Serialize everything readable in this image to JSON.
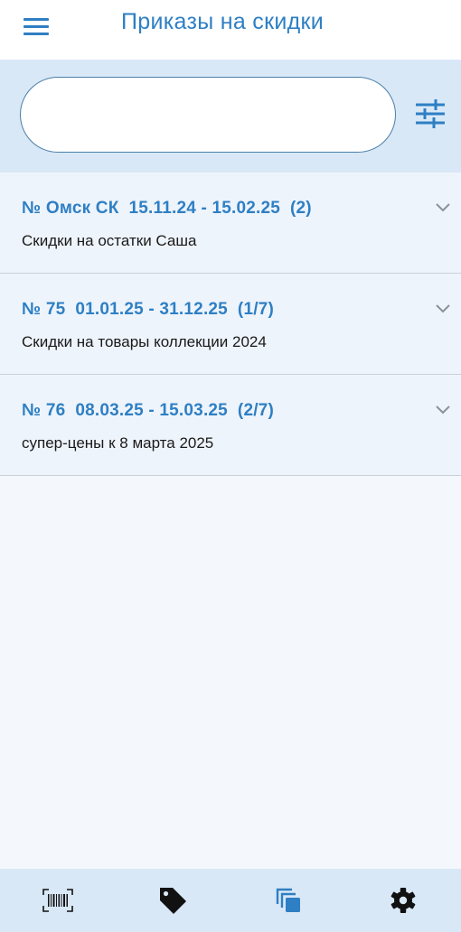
{
  "header": {
    "title": "Приказы на скидки",
    "menu_icon": "menu-icon"
  },
  "search": {
    "value": "",
    "placeholder": "",
    "filter_icon": "filter-sliders-icon"
  },
  "orders": [
    {
      "title": "№ Омск СК  15.11.24 - 15.02.25  (2)",
      "description": "Скидки на остатки Саша"
    },
    {
      "title": "№ 75  01.01.25 - 31.12.25  (1/7)",
      "description": "Скидки на товары коллекции 2024"
    },
    {
      "title": "№ 76  08.03.25 - 15.03.25  (2/7)",
      "description": "супер-цены к 8 марта 2025"
    }
  ],
  "bottom_nav": [
    {
      "icon": "barcode-scanner-icon"
    },
    {
      "icon": "price-tag-icon"
    },
    {
      "icon": "copy-stack-icon"
    },
    {
      "icon": "settings-gear-icon"
    }
  ],
  "colors": {
    "accent": "#2e7fc4",
    "header_band": "#d9e8f7",
    "list_bg": "#eef4fb",
    "page_bg": "#f4f7fc"
  }
}
